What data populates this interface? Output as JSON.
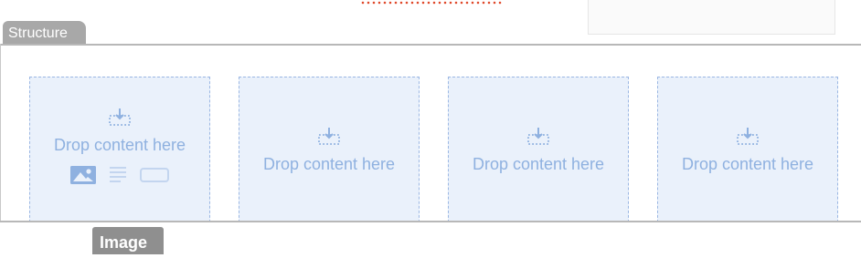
{
  "structure": {
    "tab_label": "Structure",
    "columns": [
      {
        "label": "Drop content here"
      },
      {
        "label": "Drop content here"
      },
      {
        "label": "Drop content here"
      },
      {
        "label": "Drop content here"
      }
    ]
  },
  "toolbar": {
    "icons": [
      "image-icon",
      "text-icon",
      "button-icon"
    ]
  },
  "tooltip": {
    "label": "Image"
  },
  "colors": {
    "drop_bg": "#eaf1fb",
    "drop_accent": "#8fb1e0",
    "tab_bg": "#a8a8a8",
    "tooltip_bg": "#8f8f8f",
    "indicator_dots": "#e04a2c"
  }
}
